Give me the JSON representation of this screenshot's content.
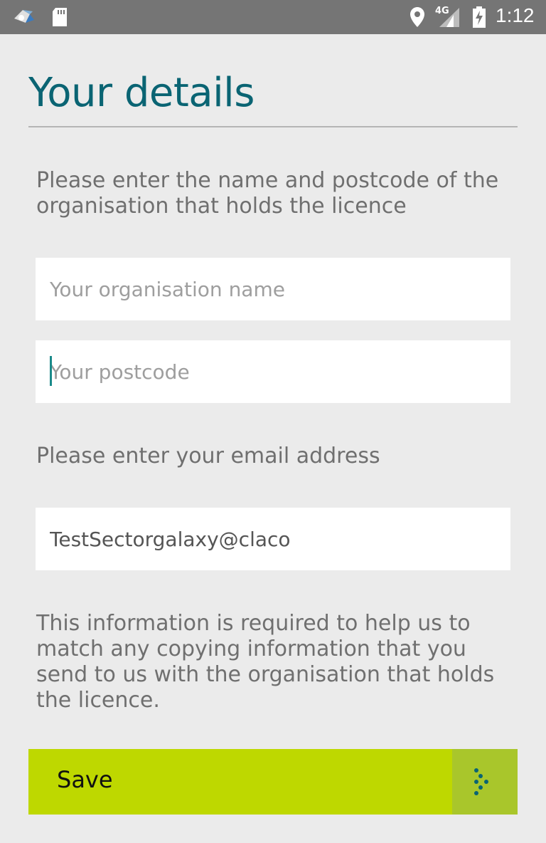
{
  "status_bar": {
    "network": "4G",
    "time": "1:12",
    "icons": [
      "app-notification-icon",
      "sd-card-icon",
      "location-icon",
      "signal-icon",
      "battery-charging-icon"
    ]
  },
  "page": {
    "title": "Your details",
    "intro": "Please enter the name and postcode of the organisation that holds the licence",
    "email_prompt": "Please enter your email address",
    "info": "This information is required to help us to match any copying information that you send to us with the organisation that holds the licence."
  },
  "form": {
    "organisation": {
      "placeholder": "Your organisation name",
      "value": ""
    },
    "postcode": {
      "placeholder": "Your postcode",
      "value": ""
    },
    "email": {
      "placeholder": "",
      "value": "TestSectorgalaxy@claco"
    }
  },
  "save_button": {
    "label": "Save",
    "icon": "dotted-arrow-icon"
  },
  "colors": {
    "title": "#0a6473",
    "accent_button": "#bed800",
    "accent_button_icon_bg": "#a9c62b",
    "status_bar": "#757575",
    "background": "#ebebeb"
  }
}
